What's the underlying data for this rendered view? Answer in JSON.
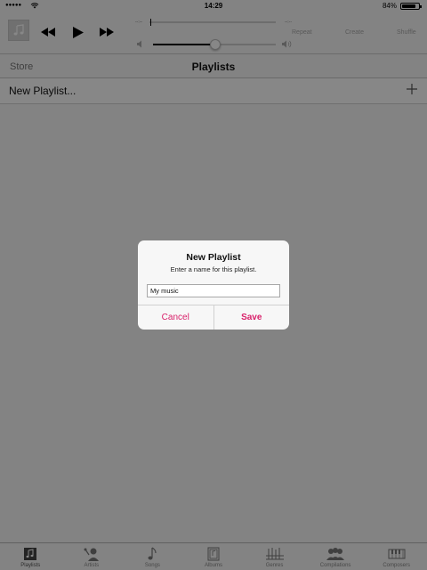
{
  "status": {
    "time": "14:29",
    "battery": "84%",
    "battery_level": 0.84
  },
  "player": {
    "time_elapsed": "--:--",
    "time_remaining": "--:--",
    "volume_level": 0.51,
    "repeat_label": "Repeat",
    "create_label": "Create",
    "shuffle_label": "Shuffle"
  },
  "nav": {
    "store_label": "Store",
    "title": "Playlists"
  },
  "list": {
    "new_playlist_label": "New Playlist..."
  },
  "dialog": {
    "title": "New Playlist",
    "message": "Enter a name for this playlist.",
    "input_value": "My music",
    "cancel_label": "Cancel",
    "save_label": "Save"
  },
  "tabs": [
    {
      "label": "Playlists",
      "icon": "playlists-icon"
    },
    {
      "label": "Artists",
      "icon": "artists-icon"
    },
    {
      "label": "Songs",
      "icon": "songs-icon"
    },
    {
      "label": "Albums",
      "icon": "albums-icon"
    },
    {
      "label": "Genres",
      "icon": "genres-icon"
    },
    {
      "label": "Compilations",
      "icon": "compilations-icon"
    },
    {
      "label": "Composers",
      "icon": "composers-icon"
    }
  ],
  "colors": {
    "accent": "#d9206a"
  }
}
